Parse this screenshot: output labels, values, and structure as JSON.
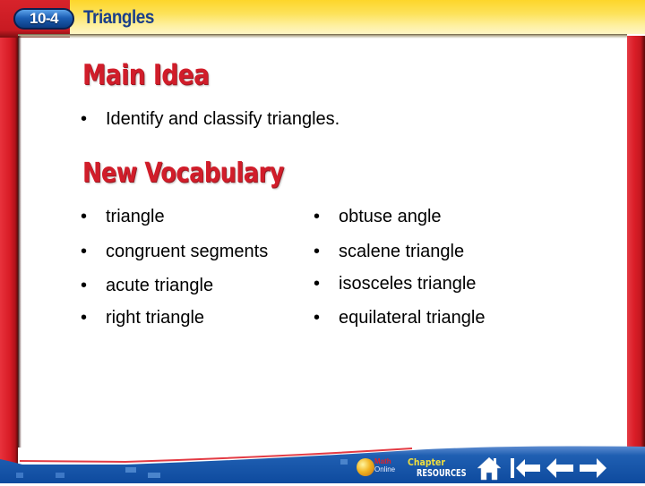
{
  "header": {
    "lesson_number": "10-4",
    "lesson_title": "Triangles"
  },
  "main_idea": {
    "heading": "Main Idea",
    "bullets": [
      "Identify and classify triangles."
    ]
  },
  "new_vocabulary": {
    "heading": "New Vocabulary",
    "bullet_glyph": "•",
    "left_column": [
      "triangle",
      "congruent segments",
      "acute triangle",
      "right triangle"
    ],
    "right_column": [
      "obtuse angle",
      "scalene triangle",
      "isosceles triangle",
      "equilateral triangle"
    ]
  },
  "footer": {
    "math_online": {
      "line1": "Math",
      "line2": "Online",
      "icon": "globe-mouse-icon"
    },
    "chapter_resources": {
      "line1": "Chapter",
      "line2": "RESOURCES"
    },
    "nav_buttons": [
      {
        "name": "home",
        "icon": "home-icon"
      },
      {
        "name": "first",
        "icon": "first-slide-icon"
      },
      {
        "name": "previous",
        "icon": "left-arrow-icon"
      },
      {
        "name": "next",
        "icon": "right-arrow-icon"
      }
    ]
  },
  "colors": {
    "frame_red": "#d81c26",
    "header_yellow": "#fdd62a",
    "heading_red": "#d11d2a",
    "title_blue": "#1a3e8a",
    "footer_blue": "#1150a6"
  }
}
